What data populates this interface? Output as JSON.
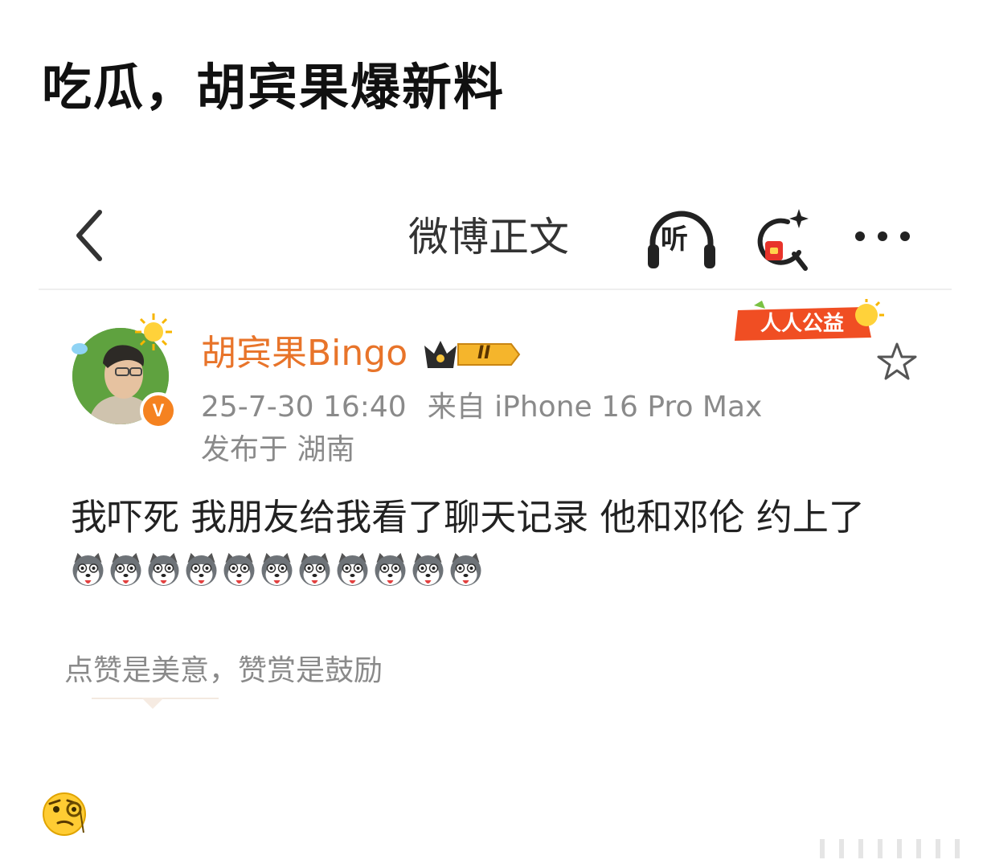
{
  "headline": "吃瓜，胡宾果爆新料",
  "navbar": {
    "title": "微博正文",
    "listen_label": "听"
  },
  "post": {
    "username": "胡宾果Bingo",
    "level_badge": "II",
    "v_badge": "V",
    "charity_badge": "人人公益",
    "timestamp": "25-7-30 16:40",
    "source": "来自 iPhone 16 Pro Max",
    "location": "发布于 湖南",
    "text": "我吓死 我朋友给我看了聊天记录 他和邓伦 约上了",
    "emoji_count": 11,
    "emoji_name": "husky-emoji",
    "reward_text": "点赞是美意，赞赏是鼓励"
  },
  "colors": {
    "username": "#e8742a",
    "meta": "#8a8a8a",
    "v_badge": "#f58220",
    "charity": "#f04e23"
  },
  "icons": [
    "back-icon",
    "headphones-icon",
    "search-icon",
    "more-icon",
    "star-icon",
    "crown-icon",
    "sun-icon",
    "thinking-emoji-icon"
  ]
}
